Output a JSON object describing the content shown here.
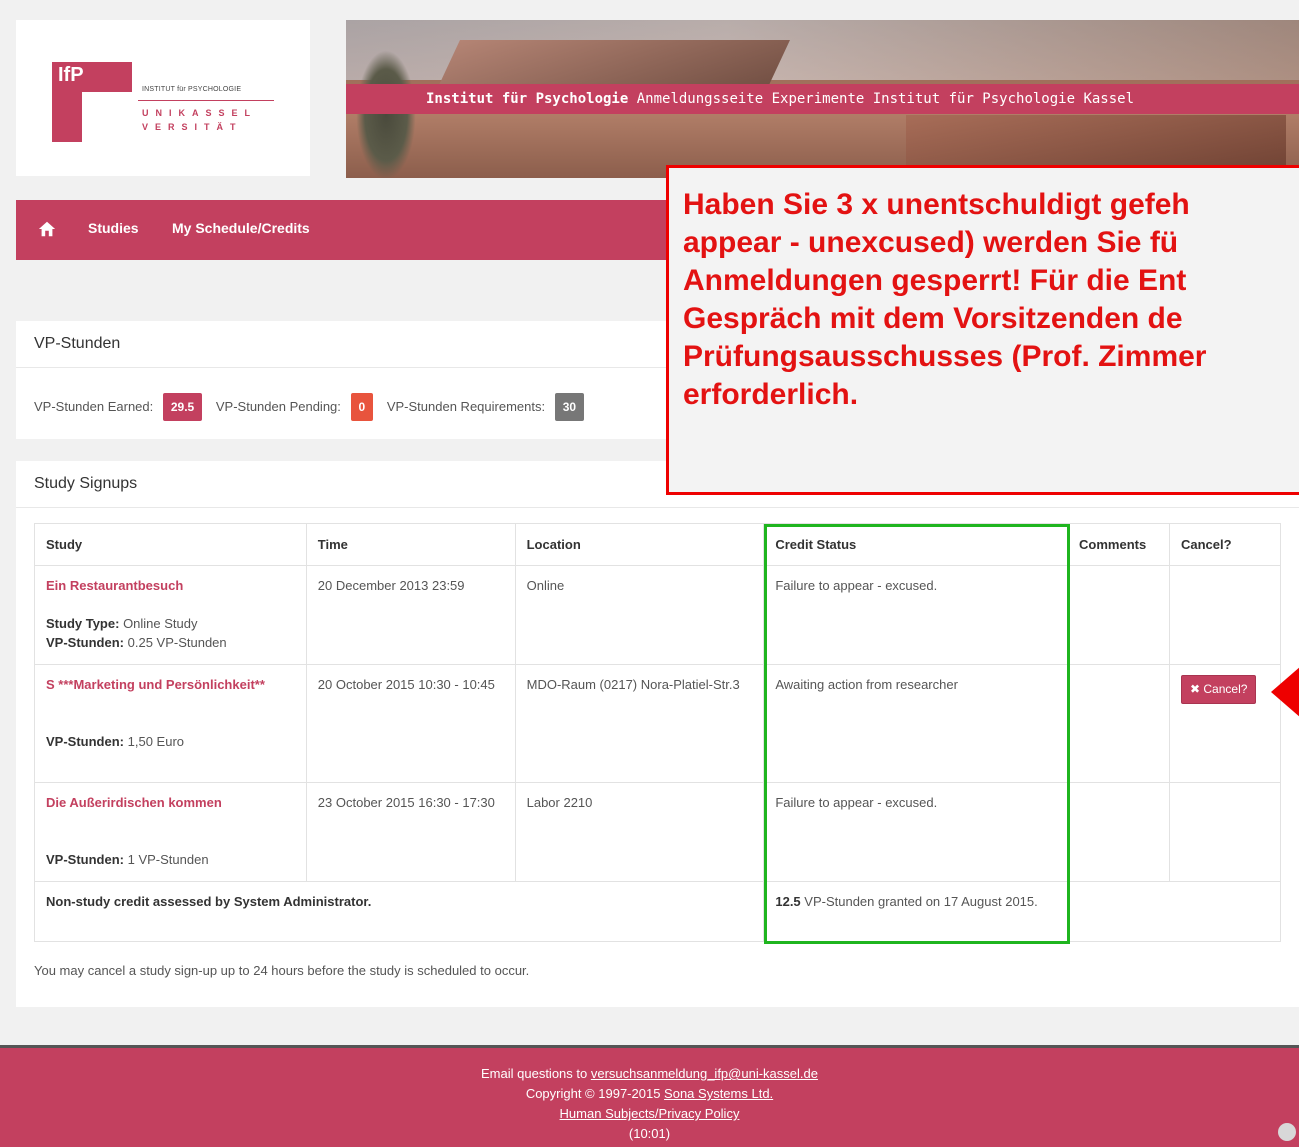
{
  "logo": {
    "mark": "IfP",
    "institute": "INSTITUT für PSYCHOLOGIE",
    "uni_line1": "UNIKASSEL",
    "uni_line2": "VERSITÄT"
  },
  "banner": {
    "bold": "Institut für Psychologie",
    "rest": " Anmeldungsseite Experimente Institut für Psychologie Kassel"
  },
  "nav": {
    "items": [
      {
        "label": "Studies"
      },
      {
        "label": "My Schedule/Credits"
      }
    ]
  },
  "vp_panel": {
    "title": "VP-Stunden",
    "earned_label": "VP-Stunden Earned:",
    "earned_value": "29.5",
    "pending_label": "VP-Stunden Pending:",
    "pending_value": "0",
    "requirements_label": "VP-Stunden Requirements:",
    "requirements_value": "30",
    "colors": {
      "earned": "#c3405f",
      "pending": "#e8543d",
      "requirements": "#777777"
    }
  },
  "signups": {
    "title": "Study Signups",
    "columns": [
      "Study",
      "Time",
      "Location",
      "Credit Status",
      "Comments",
      "Cancel?"
    ],
    "rows": [
      {
        "study": "Ein Restaurantbesuch",
        "study_type_label": "Study Type:",
        "study_type": "Online Study",
        "vp_label": "VP-Stunden:",
        "vp_value": "0.25 VP-Stunden",
        "time": "20 December 2013 23:59",
        "location": "Online",
        "credit_status": "Failure to appear - excused.",
        "comments": "",
        "cancel": ""
      },
      {
        "study": "S ***Marketing und Persönlichkeit**",
        "vp_label": "VP-Stunden:",
        "vp_value": "1,50 Euro",
        "time": "20 October 2015 10:30 - 10:45",
        "location": "MDO-Raum (0217) Nora-Platiel-Str.3",
        "credit_status": "Awaiting action from researcher",
        "comments": "",
        "cancel": "✖ Cancel?"
      },
      {
        "study": "Die Außerirdischen kommen",
        "vp_label": "VP-Stunden:",
        "vp_value": "1 VP-Stunden",
        "time": "23 October 2015 16:30 - 17:30",
        "location": "Labor 2210",
        "credit_status": "Failure to appear - excused.",
        "comments": "",
        "cancel": ""
      }
    ],
    "nonstudy": {
      "label": "Non-study credit assessed by System Administrator.",
      "amount": "12.5",
      "text": " VP-Stunden granted on 17 August 2015."
    },
    "note": "You may cancel a study sign-up up to 24 hours before the study is scheduled to occur."
  },
  "footer": {
    "email_prefix": "Email questions to ",
    "email": "versuchsanmeldung_ifp@uni-kassel.de",
    "copyright_prefix": "Copyright © 1997-2015 ",
    "company": "Sona Systems Ltd.",
    "policy": "Human Subjects/Privacy Policy",
    "time": "(10:01)"
  },
  "alert": {
    "text": "Haben Sie 3 x unentschuldigt gefeh\nappear - unexcused) werden Sie fü\nAnmeldungen gesperrt! Für die Ent\nGespräch mit dem Vorsitzenden de\nPrüfungsausschusses (Prof. Zimmer\nerforderlich."
  }
}
